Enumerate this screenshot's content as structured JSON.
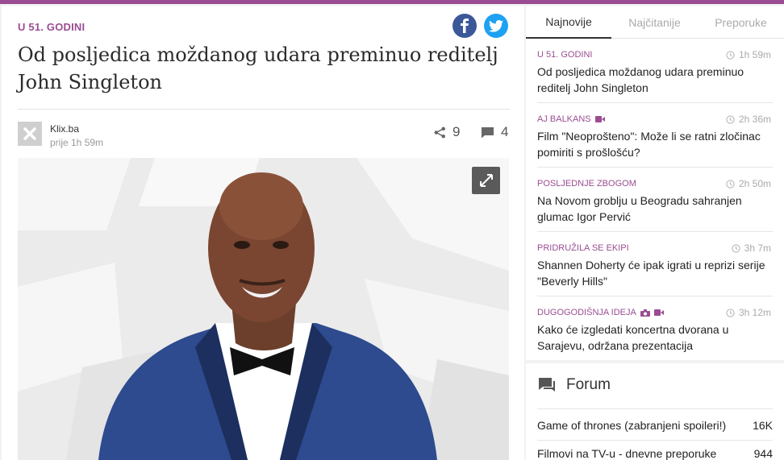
{
  "article": {
    "kicker": "U 51. GODINI",
    "headline": "Od posljedica moždanog udara preminuo reditelj John Singleton",
    "source_name": "Klix.ba",
    "source_time": "prije 1h 59m",
    "shares": "9",
    "comments": "4",
    "photo_icon": "expand-icon"
  },
  "social": {
    "facebook_icon": "facebook-icon",
    "twitter_icon": "twitter-icon"
  },
  "sidebar": {
    "tabs": [
      {
        "label": "Najnovije",
        "active": true
      },
      {
        "label": "Najčitanije",
        "active": false
      },
      {
        "label": "Preporuke",
        "active": false
      }
    ],
    "items": [
      {
        "category": "U 51. GODINI",
        "time": "1h 59m",
        "title": "Od posljedica moždanog udara preminuo reditelj John Singleton",
        "media": []
      },
      {
        "category": "AJ BALKANS",
        "time": "2h 36m",
        "title": "Film \"Neoprošteno\": Može li se ratni zločinac pomiriti s prošlošću?",
        "media": [
          "video-icon"
        ]
      },
      {
        "category": "POSLJEDNJE ZBOGOM",
        "time": "2h 50m",
        "title": "Na Novom groblju u Beogradu sahranjen glumac Igor Pervić",
        "media": []
      },
      {
        "category": "PRIDRUŽILA SE EKIPI",
        "time": "3h 7m",
        "title": "Shannen Doherty će ipak igrati u reprizi serije \"Beverly Hills\"",
        "media": []
      },
      {
        "category": "DUGOGODIŠNJA IDEJA",
        "time": "3h 12m",
        "title": "Kako će izgledati koncertna dvorana u Sarajevu, održana prezentacija",
        "media": [
          "camera-icon",
          "video-icon"
        ]
      }
    ]
  },
  "forum": {
    "title": "Forum",
    "rows": [
      {
        "topic": "Game of thrones (zabranjeni spoileri!)",
        "count": "16K"
      },
      {
        "topic": "Filmovi na TV-u - dnevne preporuke",
        "count": "944"
      }
    ]
  },
  "colors": {
    "accent": "#9a4d92",
    "facebook": "#3b5998",
    "twitter": "#1da1f2"
  }
}
